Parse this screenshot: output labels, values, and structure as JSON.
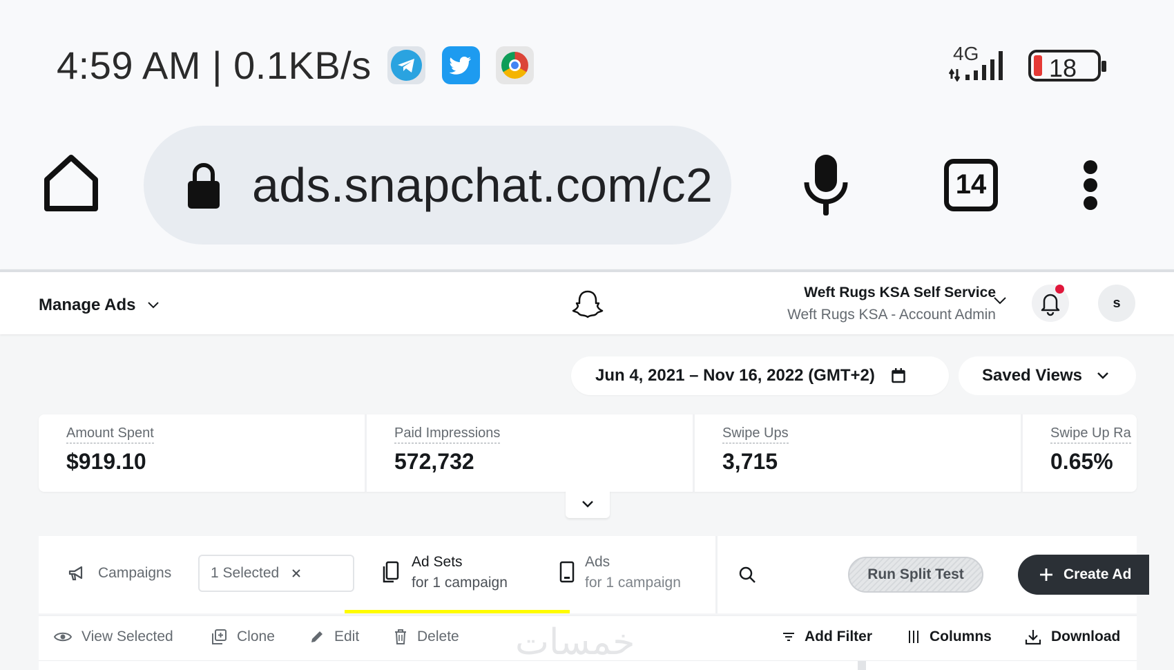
{
  "status_bar": {
    "time_speed": "4:59 AM | 0.1KB/s",
    "network_type": "4G",
    "battery": "18",
    "app_icons": [
      "telegram-icon",
      "twitter-icon",
      "chrome-icon"
    ]
  },
  "browser": {
    "url": "ads.snapchat.com/c2",
    "tab_count": "14"
  },
  "header": {
    "manage_ads": "Manage Ads",
    "account_name": "Weft Rugs KSA Self Service",
    "account_role": "Weft Rugs KSA - Account Admin",
    "avatar_initial": "s"
  },
  "toolbar": {
    "date_range": "Jun 4, 2021 – Nov 16, 2022 (GMT+2)",
    "saved_views": "Saved Views"
  },
  "stats": [
    {
      "label": "Amount Spent",
      "value": "$919.10"
    },
    {
      "label": "Paid Impressions",
      "value": "572,732"
    },
    {
      "label": "Swipe Ups",
      "value": "3,715"
    },
    {
      "label": "Swipe Up Ra",
      "value": "0.65%"
    }
  ],
  "tabs": {
    "campaigns": "Campaigns",
    "selected": "1 Selected",
    "adsets_title": "Ad Sets",
    "adsets_sub": "for 1 campaign",
    "ads_title": "Ads",
    "ads_sub": "for 1 campaign",
    "run_split_test": "Run Split Test",
    "create_ad": "Create Ad"
  },
  "actions": {
    "view_selected": "View Selected",
    "clone": "Clone",
    "edit": "Edit",
    "delete": "Delete",
    "add_filter": "Add Filter",
    "columns": "Columns",
    "download": "Download"
  },
  "watermark": "خمسات",
  "colors": {
    "accent_yellow": "#fffc00",
    "dark_button": "#2b3036",
    "notification_dot": "#e0173b"
  }
}
